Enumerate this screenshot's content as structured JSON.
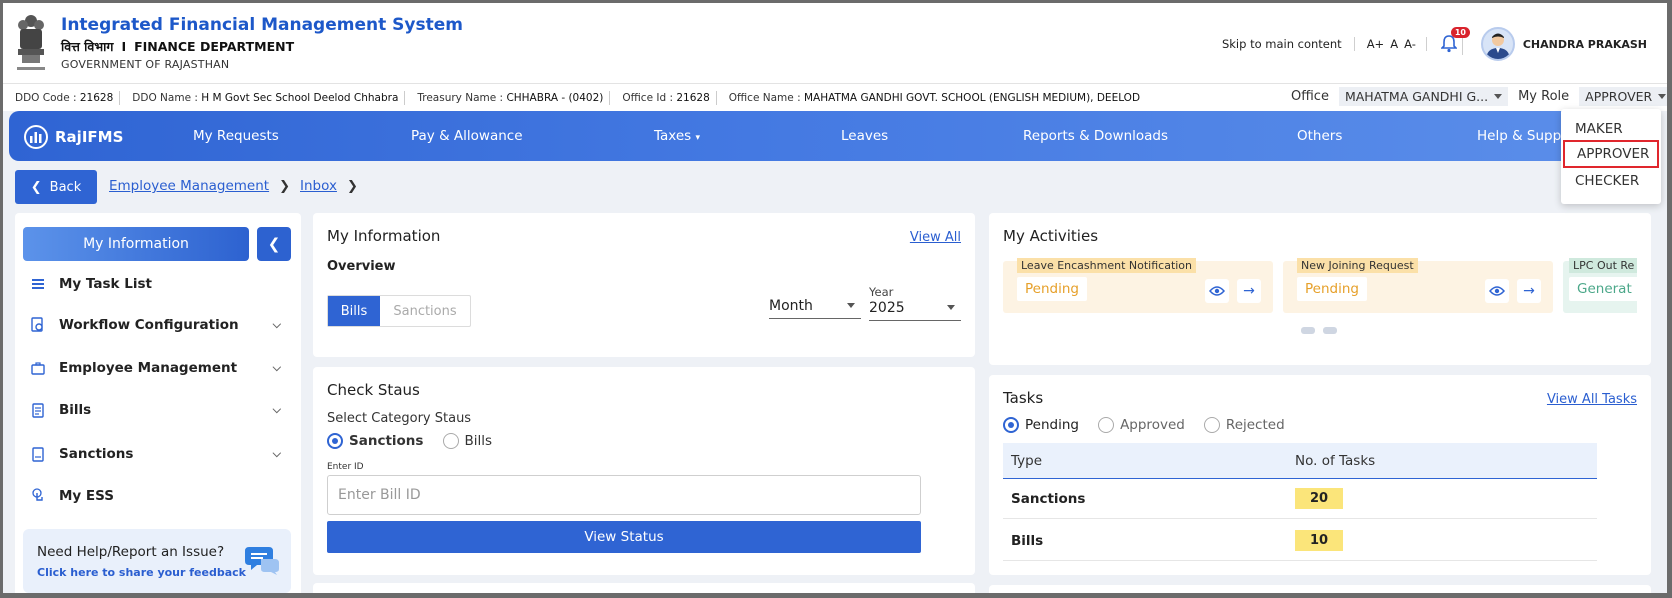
{
  "header": {
    "title": "Integrated Financial Management System",
    "dept_hindi": "वित्त विभाग",
    "dept_sep": "I",
    "dept_en": "FINANCE DEPARTMENT",
    "gov": "GOVERNMENT OF RAJASTHAN",
    "skip": "Skip to main content",
    "font_larger": "A+",
    "font_normal": "A",
    "font_smaller": "A-",
    "notif_count": "10",
    "user_name": "CHANDRA PRAKASH"
  },
  "infobar": {
    "ddo_code_label": "DDO Code :",
    "ddo_code": "21628",
    "ddo_name_label": "DDO Name :",
    "ddo_name": "H M Govt Sec School Deelod Chhabra",
    "treasury_label": "Treasury Name :",
    "treasury": "CHHABRA - (0402)",
    "office_id_label": "Office Id :",
    "office_id": "21628",
    "office_name_label": "Office Name :",
    "office_name": "MAHATMA GANDHI GOVT. SCHOOL (ENGLISH MEDIUM), DEELOD",
    "office_sel_label": "Office",
    "office_sel_value": "MAHATMA GANDHI G...",
    "role_label": "My Role",
    "role_value": "APPROVER"
  },
  "nav": {
    "logo": "RajIFMS",
    "items": [
      "My Requests",
      "Pay & Allowance",
      "Taxes",
      "Leaves",
      "Reports & Downloads",
      "Others",
      "Help & Support"
    ]
  },
  "role_menu": [
    "MAKER",
    "APPROVER",
    "CHECKER"
  ],
  "breadcrumb": {
    "back": "Back",
    "items": [
      "Employee Management",
      "Inbox"
    ]
  },
  "sidebar": {
    "header": "My Information",
    "items": [
      "My Task List",
      "Workflow Configuration",
      "Employee Management",
      "Bills",
      "Sanctions",
      "My ESS"
    ],
    "help_title": "Need Help/Report an Issue?",
    "help_link": "Click here to share your feedback"
  },
  "my_info": {
    "title": "My Information",
    "view_all": "View All",
    "overview": "Overview",
    "tab_bills": "Bills",
    "tab_sanctions": "Sanctions",
    "month_value": "Month",
    "year_label": "Year",
    "year_value": "2025"
  },
  "check_status": {
    "title": "Check Staus",
    "category_label": "Select Category Staus",
    "opt_sanctions": "Sanctions",
    "opt_bills": "Bills",
    "input_label": "Enter ID",
    "input_placeholder": "Enter Bill ID",
    "button": "View Status"
  },
  "activities": {
    "title": "My Activities",
    "cards": [
      {
        "label": "Leave Encashment Notification",
        "status": "Pending"
      },
      {
        "label": "New Joining Request",
        "status": "Pending"
      },
      {
        "label": "LPC Out Re",
        "status": "Generat"
      }
    ]
  },
  "tasks": {
    "title": "Tasks",
    "view_all": "View All Tasks",
    "filters": [
      "Pending",
      "Approved",
      "Rejected"
    ],
    "col_type": "Type",
    "col_count": "No. of Tasks",
    "rows": [
      {
        "type": "Sanctions",
        "count": "20"
      },
      {
        "type": "Bills",
        "count": "10"
      }
    ]
  },
  "colors": {
    "primary": "#2f64d3",
    "pending": "#e6a02a",
    "highlight": "#e0262d"
  }
}
